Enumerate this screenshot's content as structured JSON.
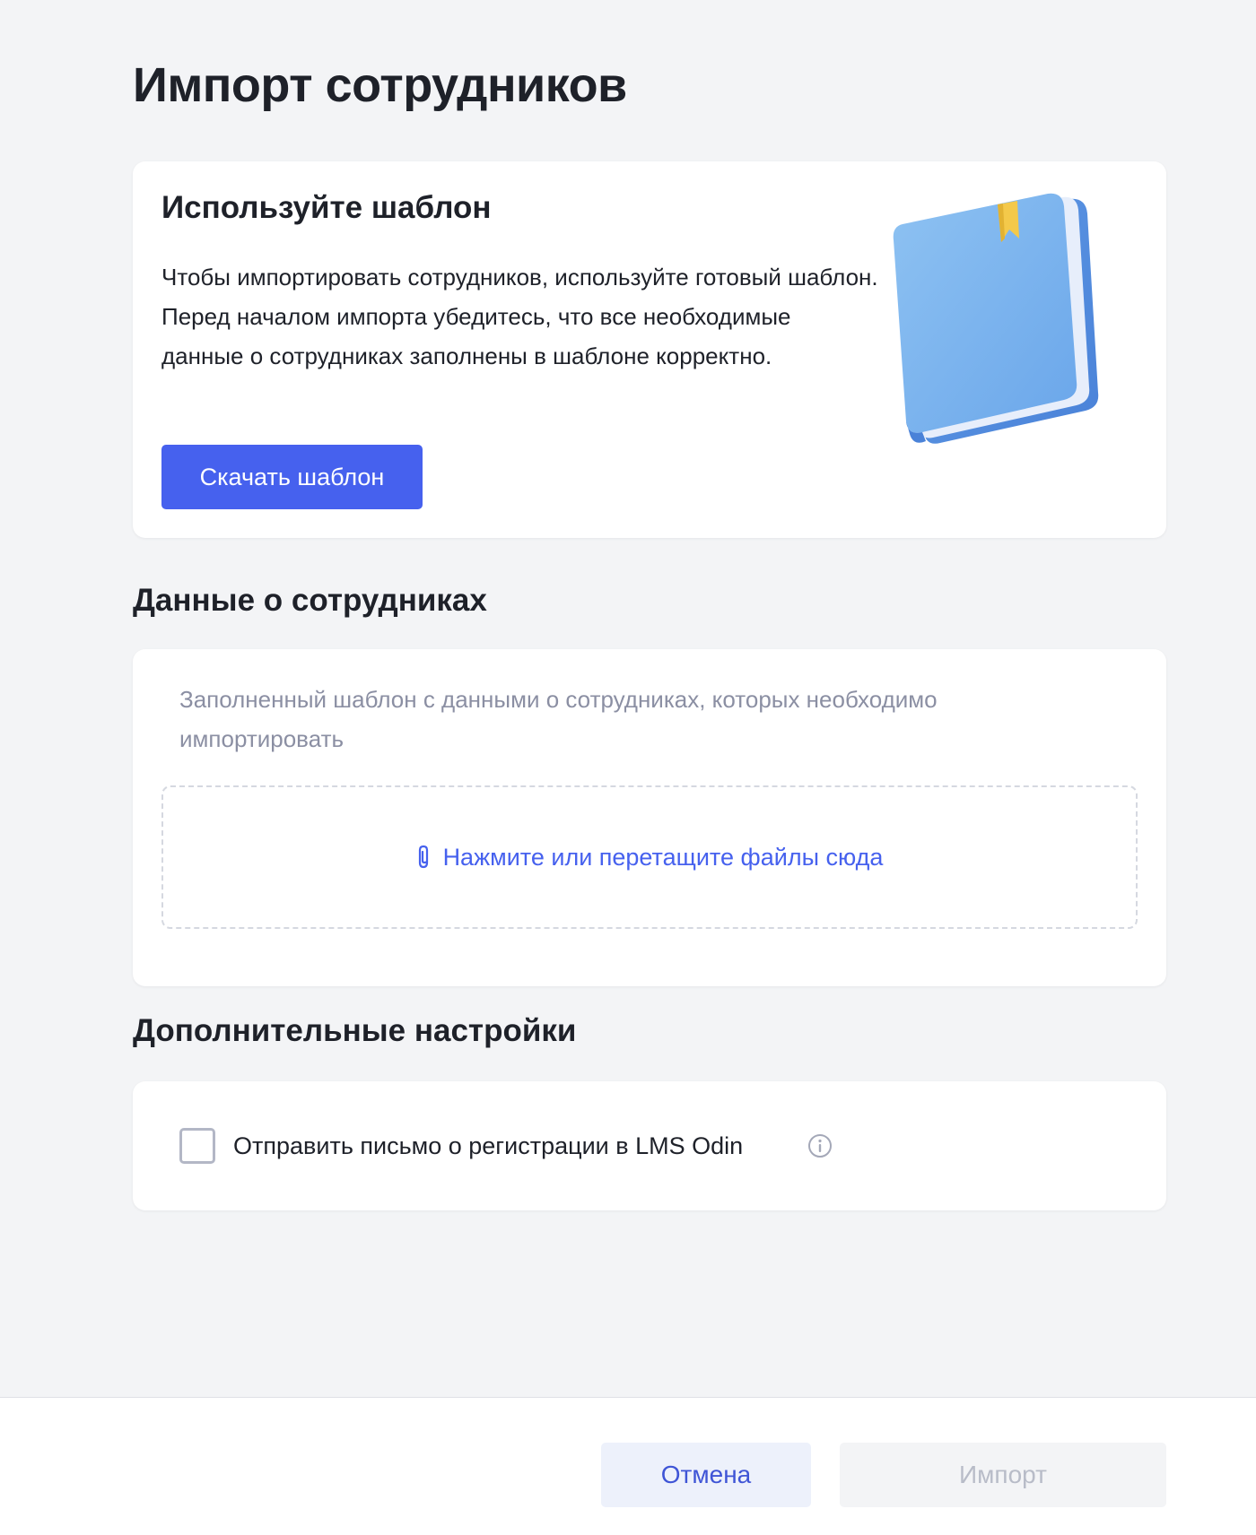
{
  "page": {
    "title": "Импорт сотрудников"
  },
  "template_card": {
    "title": "Используйте шаблон",
    "text": "Чтобы импортировать сотрудников, используйте готовый шаблон. Перед началом импорта убедитесь, что все необходимые данные о сотрудниках заполнены в шаблоне корректно.",
    "download_label": "Скачать шаблон",
    "illustration_icon": "book-icon"
  },
  "employees_section": {
    "title": "Данные о сотрудниках",
    "hint": "Заполненный шаблон с данными о сотрудниках, которых необходимо импортировать",
    "dropzone_label": "Нажмите или перетащите файлы сюда",
    "dropzone_icon": "paperclip-icon"
  },
  "settings_section": {
    "title": "Дополнительные настройки",
    "send_email_label": "Отправить письмо о регистрации в LMS Odin",
    "send_email_checked": false,
    "info_icon": "info-icon"
  },
  "footer": {
    "cancel_label": "Отмена",
    "import_label": "Импорт",
    "import_disabled": true
  },
  "colors": {
    "accent": "#4661ee",
    "background": "#f3f4f6",
    "card": "#ffffff",
    "muted_text": "#8b8fa3"
  }
}
